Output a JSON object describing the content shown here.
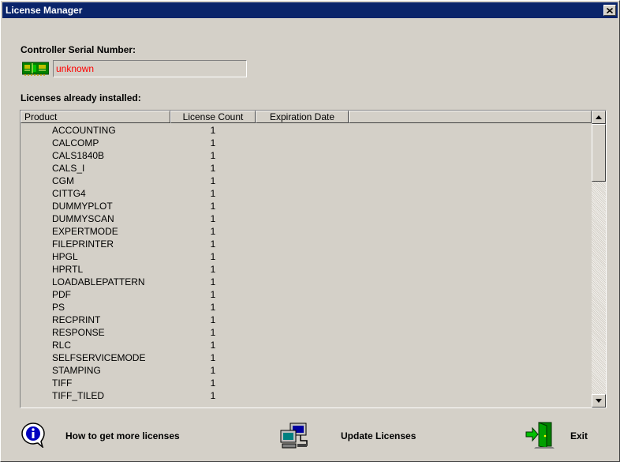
{
  "window": {
    "title": "License Manager"
  },
  "serial": {
    "label": "Controller Serial Number:",
    "value": "unknown"
  },
  "licenses": {
    "label": "Licenses already installed:",
    "columns": [
      "Product",
      "License Count",
      "Expiration Date"
    ],
    "rows": [
      {
        "product": "ACCOUNTING",
        "count": "1",
        "expiration": ""
      },
      {
        "product": "CALCOMP",
        "count": "1",
        "expiration": ""
      },
      {
        "product": "CALS1840B",
        "count": "1",
        "expiration": ""
      },
      {
        "product": "CALS_I",
        "count": "1",
        "expiration": ""
      },
      {
        "product": "CGM",
        "count": "1",
        "expiration": ""
      },
      {
        "product": "CITTG4",
        "count": "1",
        "expiration": ""
      },
      {
        "product": "DUMMYPLOT",
        "count": "1",
        "expiration": ""
      },
      {
        "product": "DUMMYSCAN",
        "count": "1",
        "expiration": ""
      },
      {
        "product": "EXPERTMODE",
        "count": "1",
        "expiration": ""
      },
      {
        "product": "FILEPRINTER",
        "count": "1",
        "expiration": ""
      },
      {
        "product": "HPGL",
        "count": "1",
        "expiration": ""
      },
      {
        "product": "HPRTL",
        "count": "1",
        "expiration": ""
      },
      {
        "product": "LOADABLEPATTERN",
        "count": "1",
        "expiration": ""
      },
      {
        "product": "PDF",
        "count": "1",
        "expiration": ""
      },
      {
        "product": "PS",
        "count": "1",
        "expiration": ""
      },
      {
        "product": "RECPRINT",
        "count": "1",
        "expiration": ""
      },
      {
        "product": "RESPONSE",
        "count": "1",
        "expiration": ""
      },
      {
        "product": "RLC",
        "count": "1",
        "expiration": ""
      },
      {
        "product": "SELFSERVICEMODE",
        "count": "1",
        "expiration": ""
      },
      {
        "product": "STAMPING",
        "count": "1",
        "expiration": ""
      },
      {
        "product": "TIFF",
        "count": "1",
        "expiration": ""
      },
      {
        "product": "TIFF_TILED",
        "count": "1",
        "expiration": ""
      }
    ]
  },
  "actions": {
    "more_licenses": "How to get more licenses",
    "update": "Update Licenses",
    "exit": "Exit"
  },
  "icons": {
    "close": "close-icon",
    "serial": "circuit-board-icon",
    "info": "info-icon",
    "update": "computer-network-icon",
    "exit": "exit-door-icon"
  },
  "colors": {
    "titlebar": "#0a246a",
    "serial_value": "#ff0000",
    "window_bg": "#d4d0c8"
  }
}
